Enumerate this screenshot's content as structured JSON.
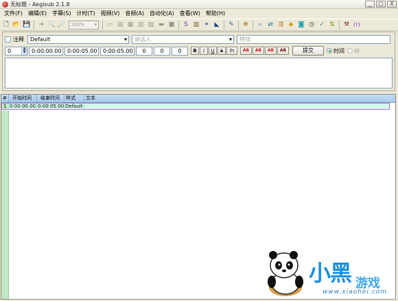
{
  "window": {
    "title": "无标题 - Aegisub 2.1.8",
    "minimize": "_",
    "maximize": "□",
    "close": "X"
  },
  "menu": [
    "文件(F)",
    "编辑(E)",
    "字幕(S)",
    "计时(T)",
    "视频(V)",
    "音频(A)",
    "自动化(A)",
    "查看(W)",
    "帮助(H)"
  ],
  "toolbar": {
    "zoom": "100%"
  },
  "edit": {
    "comment_label": "注释",
    "style": "Default",
    "actor_placeholder": "说话人",
    "effect_placeholder": "特效",
    "layer": "0",
    "start_time": "0:00:00.00",
    "end_time": "0:00:05.00",
    "duration": "0:00:05.00",
    "margin_l": "0",
    "margin_r": "0",
    "margin_v": "0",
    "bold": "B",
    "italic": "I",
    "underline": "U",
    "strike": "S",
    "font": "fn",
    "color1": "AB",
    "color2": "AB",
    "color3": "AB",
    "color4": "AB",
    "commit": "提交",
    "time_label": "时间",
    "frame_label": "帧"
  },
  "grid": {
    "headers": [
      "#",
      "开始时间",
      "结束时间",
      "样式",
      "文本"
    ],
    "rows": [
      {
        "num": "1",
        "start": "0:00:00.00",
        "end": "0:00:05.00",
        "style": "Default",
        "text": ""
      }
    ]
  },
  "watermark": {
    "brand": "小黑",
    "game": "游戏",
    "url": "www.xiaohei.com"
  }
}
